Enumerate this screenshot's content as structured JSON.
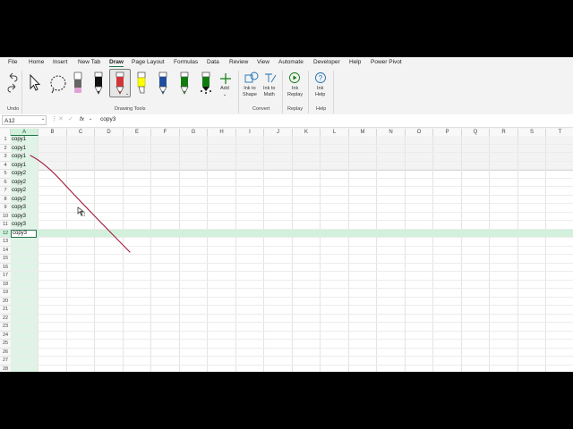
{
  "menu_tabs": [
    "File",
    "Home",
    "Insert",
    "New Tab",
    "Draw",
    "Page Layout",
    "Formulas",
    "Data",
    "Review",
    "View",
    "Automate",
    "Developer",
    "Help",
    "Power Pivot"
  ],
  "active_tab": "Draw",
  "ribbon": {
    "groups": {
      "undo": "Undo",
      "drawing_tools": "Drawing Tools",
      "convert": "Convert",
      "replay": "Replay",
      "help": "Help"
    },
    "add_label": "Add",
    "ink_to_shape": [
      "Ink to",
      "Shape"
    ],
    "ink_to_math": [
      "Ink to",
      "Math"
    ],
    "ink_replay": [
      "Ink",
      "Replay"
    ],
    "ink_help": [
      "Ink",
      "Help"
    ],
    "pen_colors": [
      "#000000",
      "#d13438",
      "#ffff00",
      "#1f4e9e",
      "#107c10",
      "#107c10"
    ],
    "highlighter_color": "#e3a1d8"
  },
  "formula_bar": {
    "name_box": "A12",
    "fx": "fx",
    "value": "copy3"
  },
  "grid": {
    "columns": [
      "A",
      "B",
      "C",
      "D",
      "E",
      "F",
      "G",
      "H",
      "I",
      "J",
      "K",
      "L",
      "M",
      "N",
      "O",
      "P",
      "Q",
      "R",
      "S",
      "T"
    ],
    "rows": [
      "1",
      "2",
      "3",
      "4",
      "5",
      "6",
      "7",
      "8",
      "9",
      "10",
      "11",
      "12",
      "13",
      "14",
      "15",
      "16",
      "17",
      "18",
      "19",
      "20",
      "21",
      "22",
      "23",
      "24",
      "25",
      "26",
      "27",
      "28"
    ],
    "column_a": [
      "copy1",
      "copy1",
      "copy1",
      "copy1",
      "copy2",
      "copy2",
      "copy2",
      "copy2",
      "copy3",
      "copy3",
      "copy3",
      "copy3"
    ],
    "selected_row": "12",
    "ink_color": "#a01a3c"
  }
}
